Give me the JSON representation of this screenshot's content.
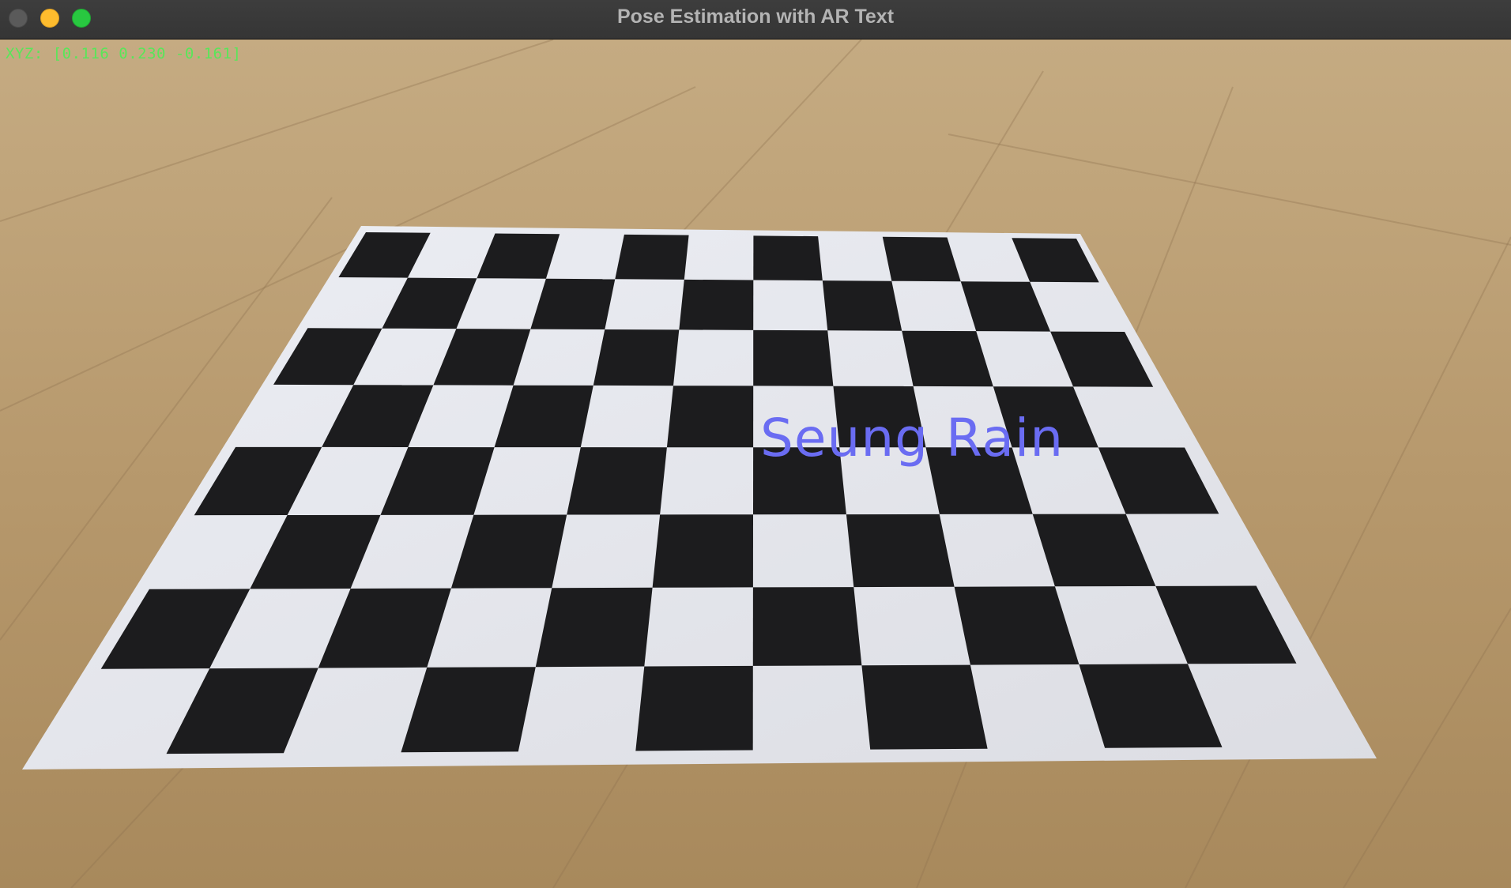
{
  "window": {
    "title": "Pose Estimation with AR Text"
  },
  "overlay": {
    "coords_text": "XYZ: [0.116 0.230 -0.161]",
    "coords_color": "#59e659",
    "ar_text": "Seung Rain",
    "ar_text_color": "#6a6cf2"
  },
  "scene": {
    "floor_color": "#b89a6e",
    "board_paper_color": "#e6e7ee",
    "board_square_color": "#1c1c1e",
    "board_rows": 8,
    "board_cols": 11
  },
  "icons": {
    "close": "close-dot-icon",
    "minimize": "minimize-dot-icon",
    "zoom": "zoom-dot-icon"
  }
}
